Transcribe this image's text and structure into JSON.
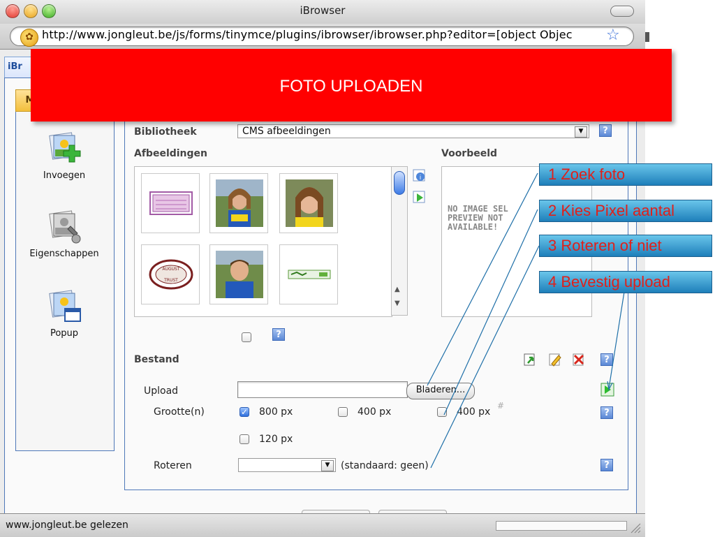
{
  "window": {
    "title": "iBrowser",
    "url": "http://www.jongleut.be/js/forms/tinymce/plugins/ibrowser/ibrowser.php?editor=[object Objec"
  },
  "tab": {
    "label": "iBr"
  },
  "sidebar": {
    "active_tab_letter": "M",
    "items": [
      {
        "label": "Invoegen",
        "icon": "insert-image-icon"
      },
      {
        "label": "Eigenschappen",
        "icon": "image-properties-icon"
      },
      {
        "label": "Popup",
        "icon": "popup-window-icon"
      }
    ]
  },
  "library": {
    "label": "Bibliotheek",
    "selected": "CMS afbeeldingen"
  },
  "images": {
    "label": "Afbeeldingen",
    "thumbs": [
      {
        "name": "pink-stamp-thumb"
      },
      {
        "name": "woman-photo-thumb"
      },
      {
        "name": "woman-closeup-thumb"
      },
      {
        "name": "august-trust-logo-thumb"
      },
      {
        "name": "man-photo-thumb"
      },
      {
        "name": "green-banner-thumb"
      }
    ]
  },
  "preview": {
    "label": "Voorbeeld",
    "no_image_text": "NO IMAGE SEL\nPREVIEW NOT\nAVAILABLE!"
  },
  "file": {
    "label": "Bestand",
    "upload_label": "Upload",
    "browse_button": "Bladeren...",
    "size_label": "Grootte(n)",
    "sizes": [
      {
        "label": "800 px",
        "checked": true
      },
      {
        "label": "400 px",
        "checked": false
      },
      {
        "label": "400 px",
        "checked": false
      },
      {
        "label": "120 px",
        "checked": false
      }
    ],
    "rotate_label": "Roteren",
    "rotate_hint": "(standaard: geen)"
  },
  "status": {
    "text": "www.jongleut.be gelezen"
  },
  "overlay": {
    "banner": "FOTO UPLOADEN",
    "callouts": [
      "1 Zoek foto",
      "2 Kies Pixel aantal",
      "3 Roteren of niet",
      "4 Bevestig upload"
    ]
  }
}
